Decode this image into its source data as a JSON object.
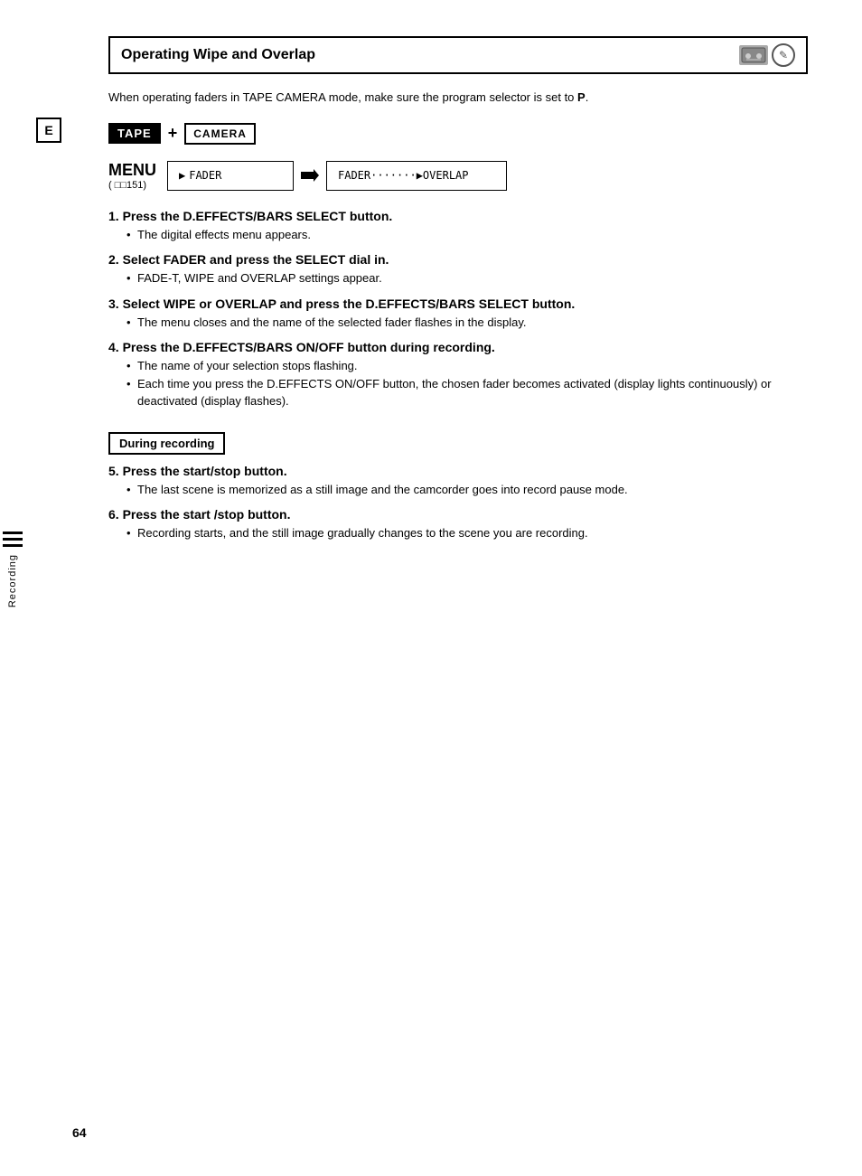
{
  "page": {
    "number": "64",
    "section_marker": "E",
    "sidebar_text": "Recording"
  },
  "title": {
    "text": "Operating Wipe and Overlap"
  },
  "intro": {
    "text": "When operating faders in TAPE CAMERA mode, make sure the program selector is set to",
    "selector_symbol": "P"
  },
  "badges": {
    "tape": "TAPE",
    "plus": "+",
    "camera": "CAMERA"
  },
  "menu": {
    "label": "MENU",
    "ref": "( ",
    "ref_page": "151",
    "ref_close": ")",
    "box1_arrow": "▶",
    "box1_text": "FADER",
    "box2_arrow": "▶",
    "box2_text": "FADER·······▶OVERLAP"
  },
  "steps": [
    {
      "number": "1",
      "title": "Press the D.EFFECTS/BARS SELECT button.",
      "bullets": [
        "The digital effects menu appears."
      ]
    },
    {
      "number": "2",
      "title": "Select FADER and press the SELECT dial in.",
      "bullets": [
        "FADE-T, WIPE and OVERLAP settings appear."
      ]
    },
    {
      "number": "3",
      "title": "Select WIPE or OVERLAP and press the D.EFFECTS/BARS SELECT button.",
      "bullets": [
        "The menu closes and the name of the selected fader flashes in the display."
      ]
    },
    {
      "number": "4",
      "title": "Press the D.EFFECTS/BARS ON/OFF button during recording.",
      "bullets": [
        "The name of your selection stops flashing.",
        "Each time you press the D.EFFECTS ON/OFF button, the chosen fader becomes activated (display lights continuously) or deactivated (display flashes)."
      ]
    }
  ],
  "during_recording": {
    "label": "During recording"
  },
  "steps_during": [
    {
      "number": "5",
      "title": "Press the start/stop button.",
      "bullets": [
        "The last scene is memorized as a still image and the camcorder goes into record pause mode."
      ]
    },
    {
      "number": "6",
      "title": "Press the start /stop button.",
      "bullets": [
        "Recording starts, and the still image gradually changes to the scene you are recording."
      ]
    }
  ]
}
